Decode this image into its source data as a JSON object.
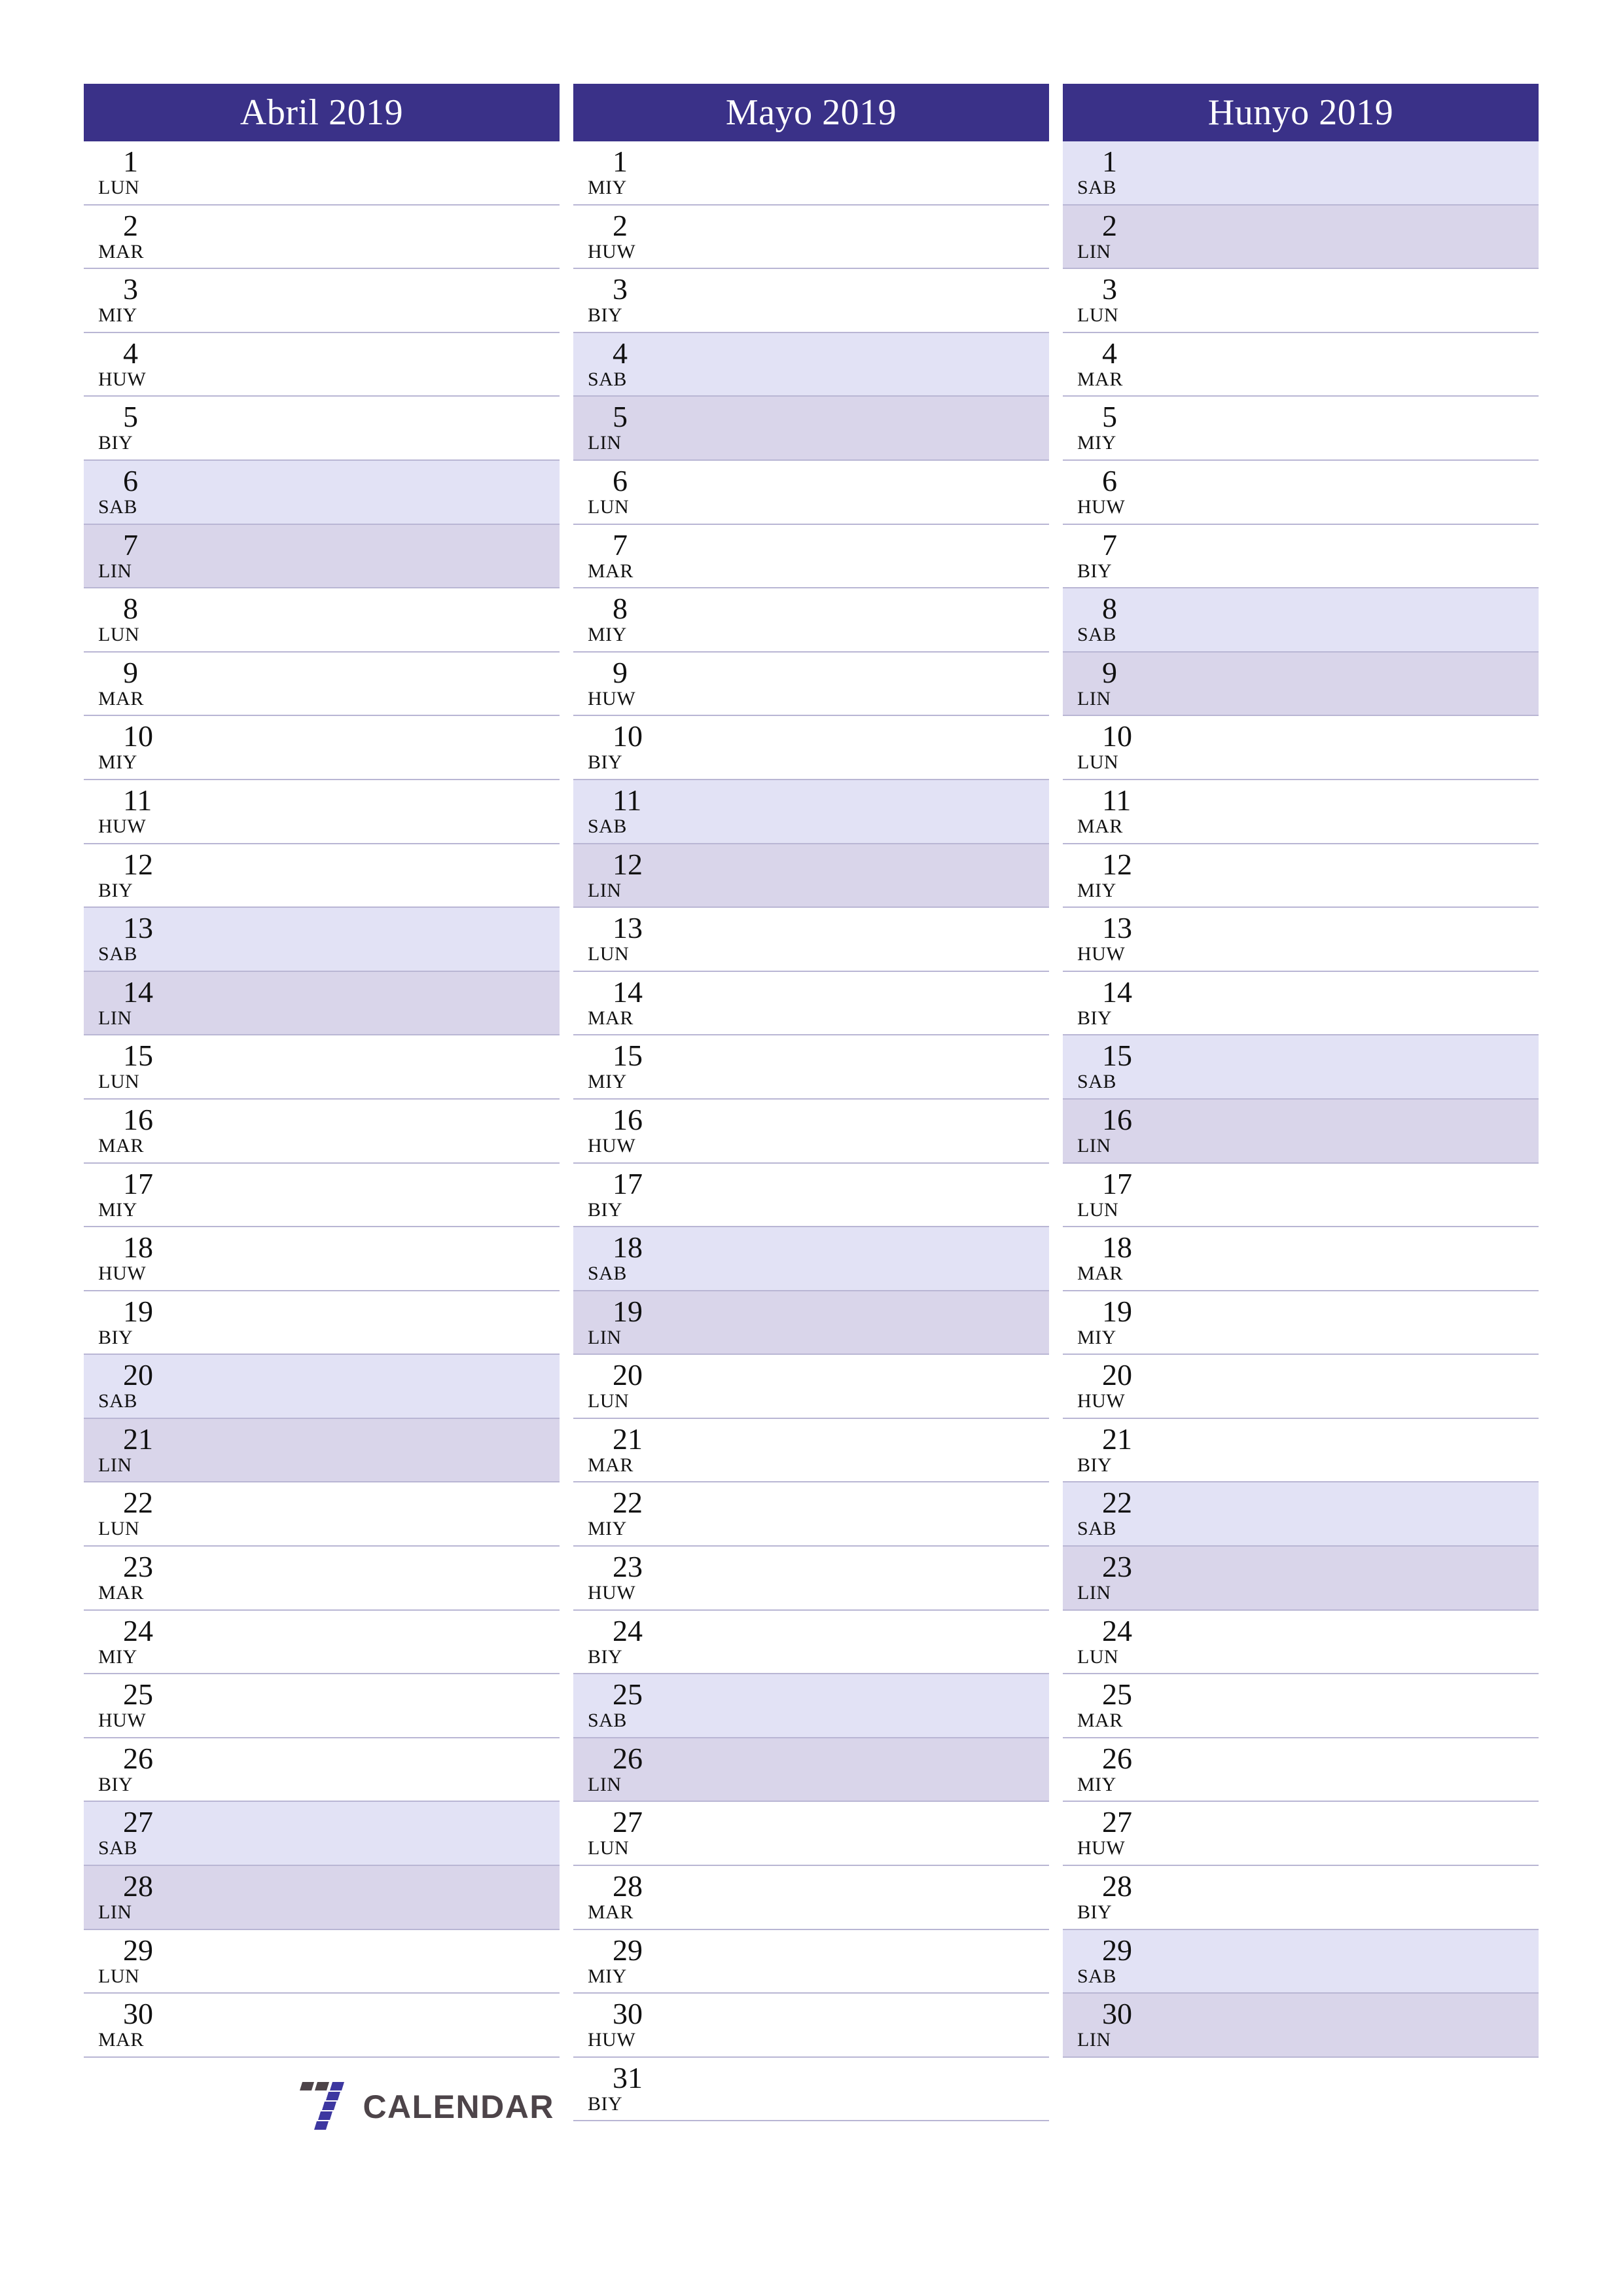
{
  "document": {
    "type": "printable-monthly-planner",
    "language_weekdays": [
      "LUN",
      "MAR",
      "MIY",
      "HUW",
      "BIY",
      "SAB",
      "LIN"
    ]
  },
  "colors": {
    "header_background": "#3a3188",
    "header_text": "#ffffff",
    "saturday_background": "#e2e2f5",
    "sunday_background": "#d9d5ea",
    "row_divider": "#b9b6d4",
    "logo_purple": "#3d37a0",
    "logo_gray": "#4d4449"
  },
  "logo": {
    "mark_name": "seven-blocks-logo-icon",
    "text": "CALENDAR"
  },
  "months": [
    {
      "title": "Abril 2019",
      "days": [
        {
          "num": "1",
          "name": "LUN",
          "kind": "weekday"
        },
        {
          "num": "2",
          "name": "MAR",
          "kind": "weekday"
        },
        {
          "num": "3",
          "name": "MIY",
          "kind": "weekday"
        },
        {
          "num": "4",
          "name": "HUW",
          "kind": "weekday"
        },
        {
          "num": "5",
          "name": "BIY",
          "kind": "weekday"
        },
        {
          "num": "6",
          "name": "SAB",
          "kind": "sat"
        },
        {
          "num": "7",
          "name": "LIN",
          "kind": "sun"
        },
        {
          "num": "8",
          "name": "LUN",
          "kind": "weekday"
        },
        {
          "num": "9",
          "name": "MAR",
          "kind": "weekday"
        },
        {
          "num": "10",
          "name": "MIY",
          "kind": "weekday"
        },
        {
          "num": "11",
          "name": "HUW",
          "kind": "weekday"
        },
        {
          "num": "12",
          "name": "BIY",
          "kind": "weekday"
        },
        {
          "num": "13",
          "name": "SAB",
          "kind": "sat"
        },
        {
          "num": "14",
          "name": "LIN",
          "kind": "sun"
        },
        {
          "num": "15",
          "name": "LUN",
          "kind": "weekday"
        },
        {
          "num": "16",
          "name": "MAR",
          "kind": "weekday"
        },
        {
          "num": "17",
          "name": "MIY",
          "kind": "weekday"
        },
        {
          "num": "18",
          "name": "HUW",
          "kind": "weekday"
        },
        {
          "num": "19",
          "name": "BIY",
          "kind": "weekday"
        },
        {
          "num": "20",
          "name": "SAB",
          "kind": "sat"
        },
        {
          "num": "21",
          "name": "LIN",
          "kind": "sun"
        },
        {
          "num": "22",
          "name": "LUN",
          "kind": "weekday"
        },
        {
          "num": "23",
          "name": "MAR",
          "kind": "weekday"
        },
        {
          "num": "24",
          "name": "MIY",
          "kind": "weekday"
        },
        {
          "num": "25",
          "name": "HUW",
          "kind": "weekday"
        },
        {
          "num": "26",
          "name": "BIY",
          "kind": "weekday"
        },
        {
          "num": "27",
          "name": "SAB",
          "kind": "sat"
        },
        {
          "num": "28",
          "name": "LIN",
          "kind": "sun"
        },
        {
          "num": "29",
          "name": "LUN",
          "kind": "weekday"
        },
        {
          "num": "30",
          "name": "MAR",
          "kind": "weekday"
        }
      ]
    },
    {
      "title": "Mayo 2019",
      "days": [
        {
          "num": "1",
          "name": "MIY",
          "kind": "weekday"
        },
        {
          "num": "2",
          "name": "HUW",
          "kind": "weekday"
        },
        {
          "num": "3",
          "name": "BIY",
          "kind": "weekday"
        },
        {
          "num": "4",
          "name": "SAB",
          "kind": "sat"
        },
        {
          "num": "5",
          "name": "LIN",
          "kind": "sun"
        },
        {
          "num": "6",
          "name": "LUN",
          "kind": "weekday"
        },
        {
          "num": "7",
          "name": "MAR",
          "kind": "weekday"
        },
        {
          "num": "8",
          "name": "MIY",
          "kind": "weekday"
        },
        {
          "num": "9",
          "name": "HUW",
          "kind": "weekday"
        },
        {
          "num": "10",
          "name": "BIY",
          "kind": "weekday"
        },
        {
          "num": "11",
          "name": "SAB",
          "kind": "sat"
        },
        {
          "num": "12",
          "name": "LIN",
          "kind": "sun"
        },
        {
          "num": "13",
          "name": "LUN",
          "kind": "weekday"
        },
        {
          "num": "14",
          "name": "MAR",
          "kind": "weekday"
        },
        {
          "num": "15",
          "name": "MIY",
          "kind": "weekday"
        },
        {
          "num": "16",
          "name": "HUW",
          "kind": "weekday"
        },
        {
          "num": "17",
          "name": "BIY",
          "kind": "weekday"
        },
        {
          "num": "18",
          "name": "SAB",
          "kind": "sat"
        },
        {
          "num": "19",
          "name": "LIN",
          "kind": "sun"
        },
        {
          "num": "20",
          "name": "LUN",
          "kind": "weekday"
        },
        {
          "num": "21",
          "name": "MAR",
          "kind": "weekday"
        },
        {
          "num": "22",
          "name": "MIY",
          "kind": "weekday"
        },
        {
          "num": "23",
          "name": "HUW",
          "kind": "weekday"
        },
        {
          "num": "24",
          "name": "BIY",
          "kind": "weekday"
        },
        {
          "num": "25",
          "name": "SAB",
          "kind": "sat"
        },
        {
          "num": "26",
          "name": "LIN",
          "kind": "sun"
        },
        {
          "num": "27",
          "name": "LUN",
          "kind": "weekday"
        },
        {
          "num": "28",
          "name": "MAR",
          "kind": "weekday"
        },
        {
          "num": "29",
          "name": "MIY",
          "kind": "weekday"
        },
        {
          "num": "30",
          "name": "HUW",
          "kind": "weekday"
        },
        {
          "num": "31",
          "name": "BIY",
          "kind": "weekday"
        }
      ]
    },
    {
      "title": "Hunyo 2019",
      "days": [
        {
          "num": "1",
          "name": "SAB",
          "kind": "sat"
        },
        {
          "num": "2",
          "name": "LIN",
          "kind": "sun"
        },
        {
          "num": "3",
          "name": "LUN",
          "kind": "weekday"
        },
        {
          "num": "4",
          "name": "MAR",
          "kind": "weekday"
        },
        {
          "num": "5",
          "name": "MIY",
          "kind": "weekday"
        },
        {
          "num": "6",
          "name": "HUW",
          "kind": "weekday"
        },
        {
          "num": "7",
          "name": "BIY",
          "kind": "weekday"
        },
        {
          "num": "8",
          "name": "SAB",
          "kind": "sat"
        },
        {
          "num": "9",
          "name": "LIN",
          "kind": "sun"
        },
        {
          "num": "10",
          "name": "LUN",
          "kind": "weekday"
        },
        {
          "num": "11",
          "name": "MAR",
          "kind": "weekday"
        },
        {
          "num": "12",
          "name": "MIY",
          "kind": "weekday"
        },
        {
          "num": "13",
          "name": "HUW",
          "kind": "weekday"
        },
        {
          "num": "14",
          "name": "BIY",
          "kind": "weekday"
        },
        {
          "num": "15",
          "name": "SAB",
          "kind": "sat"
        },
        {
          "num": "16",
          "name": "LIN",
          "kind": "sun"
        },
        {
          "num": "17",
          "name": "LUN",
          "kind": "weekday"
        },
        {
          "num": "18",
          "name": "MAR",
          "kind": "weekday"
        },
        {
          "num": "19",
          "name": "MIY",
          "kind": "weekday"
        },
        {
          "num": "20",
          "name": "HUW",
          "kind": "weekday"
        },
        {
          "num": "21",
          "name": "BIY",
          "kind": "weekday"
        },
        {
          "num": "22",
          "name": "SAB",
          "kind": "sat"
        },
        {
          "num": "23",
          "name": "LIN",
          "kind": "sun"
        },
        {
          "num": "24",
          "name": "LUN",
          "kind": "weekday"
        },
        {
          "num": "25",
          "name": "MAR",
          "kind": "weekday"
        },
        {
          "num": "26",
          "name": "MIY",
          "kind": "weekday"
        },
        {
          "num": "27",
          "name": "HUW",
          "kind": "weekday"
        },
        {
          "num": "28",
          "name": "BIY",
          "kind": "weekday"
        },
        {
          "num": "29",
          "name": "SAB",
          "kind": "sat"
        },
        {
          "num": "30",
          "name": "LIN",
          "kind": "sun"
        }
      ]
    }
  ]
}
